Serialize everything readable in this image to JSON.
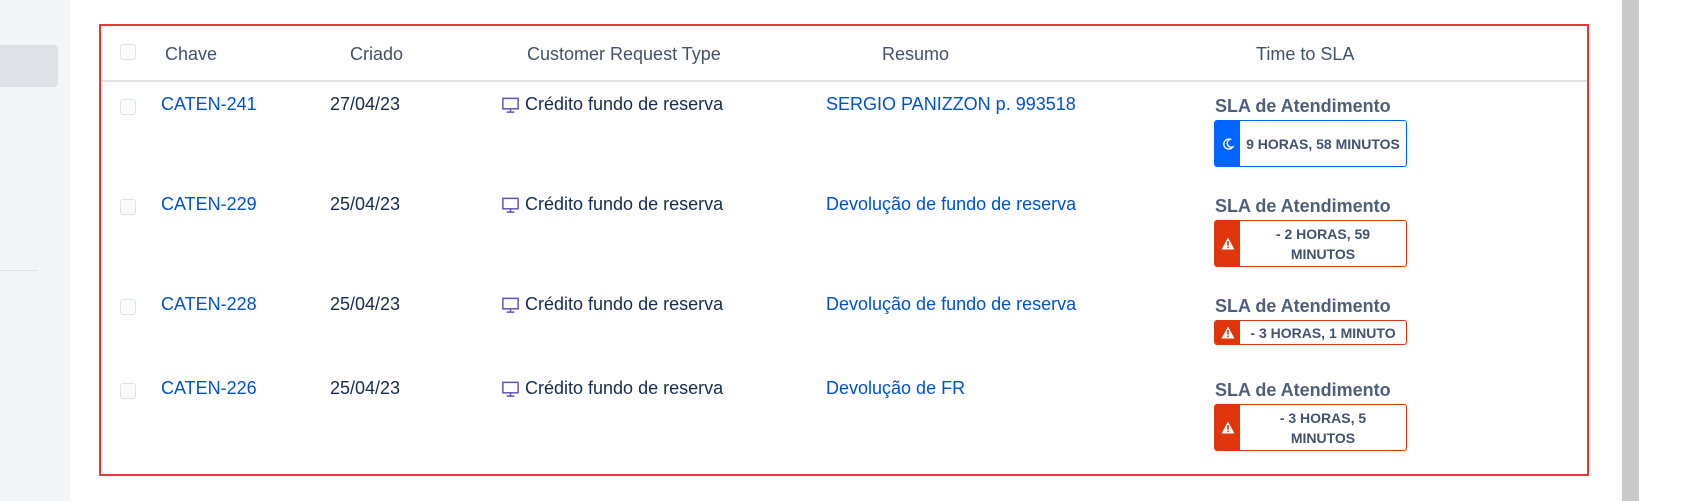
{
  "table": {
    "headers": {
      "key": "Chave",
      "created": "Criado",
      "request_type": "Customer Request Type",
      "summary": "Resumo",
      "sla": "Time to SLA"
    },
    "rows": [
      {
        "key": "CATEN-241",
        "created": "27/04/23",
        "request_type": "Crédito fundo de reserva",
        "summary": "SERGIO PANIZZON p. 993518",
        "sla_name": "SLA de Atendimento",
        "sla_value": "9 HORAS, 58 MINUTOS",
        "sla_status": "paused",
        "sla_icon": "moon-icon"
      },
      {
        "key": "CATEN-229",
        "created": "25/04/23",
        "request_type": "Crédito fundo de reserva",
        "summary": "Devolução de fundo de reserva",
        "sla_name": "SLA de Atendimento",
        "sla_value": "- 2 HORAS, 59 MINUTOS",
        "sla_status": "breached",
        "sla_icon": "warning-icon"
      },
      {
        "key": "CATEN-228",
        "created": "25/04/23",
        "request_type": "Crédito fundo de reserva",
        "summary": "Devolução de fundo de reserva",
        "sla_name": "SLA de Atendimento",
        "sla_value": "- 3 HORAS, 1 MINUTO",
        "sla_status": "breached",
        "sla_icon": "warning-icon"
      },
      {
        "key": "CATEN-226",
        "created": "25/04/23",
        "request_type": "Crédito fundo de reserva",
        "summary": "Devolução de FR",
        "sla_name": "SLA de Atendimento",
        "sla_value": "- 3 HORAS, 5 MINUTOS",
        "sla_status": "breached",
        "sla_icon": "warning-icon"
      }
    ]
  },
  "colors": {
    "link": "#0052cc",
    "sla_ok": "#0065ff",
    "sla_breached": "#de350b",
    "frame_highlight": "#e53935"
  }
}
